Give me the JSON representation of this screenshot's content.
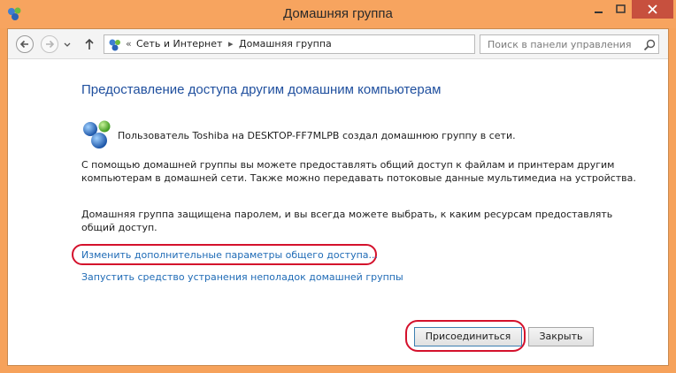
{
  "window": {
    "title": "Домашняя группа"
  },
  "nav": {
    "breadcrumb_lead": "«",
    "crumbs": [
      "Сеть и Интернет",
      "Домашняя группа"
    ],
    "search_placeholder": "Поиск в панели управления"
  },
  "content": {
    "heading": "Предоставление доступа другим домашним компьютерам",
    "owner_text": "Пользователь Toshiba на DESKTOP-FF7MLPB создал домашнюю группу в сети.",
    "para1": "С помощью домашней группы вы можете предоставлять общий доступ к файлам и принтерам другим компьютерам в домашней сети. Также можно передавать потоковые данные мультимедиа на устройства.",
    "para2": "Домашняя группа защищена паролем, и вы всегда можете выбрать, к каким ресурсам предоставлять общий доступ.",
    "link_advanced": "Изменить дополнительные параметры общего доступа...",
    "link_troubleshoot": "Запустить средство устранения неполадок домашней группы"
  },
  "buttons": {
    "join": "Присоединиться",
    "close": "Закрыть"
  },
  "colors": {
    "titlebar": "#f7a45f",
    "close_button": "#c7503e",
    "heading": "#1f4f9e",
    "link": "#1f6bb6",
    "highlight": "#d4112c"
  },
  "icons": {
    "app": "homegroup-icon",
    "back": "back-arrow-icon",
    "forward": "forward-arrow-icon",
    "up": "up-arrow-icon",
    "refresh": "refresh-icon",
    "search": "search-icon"
  }
}
